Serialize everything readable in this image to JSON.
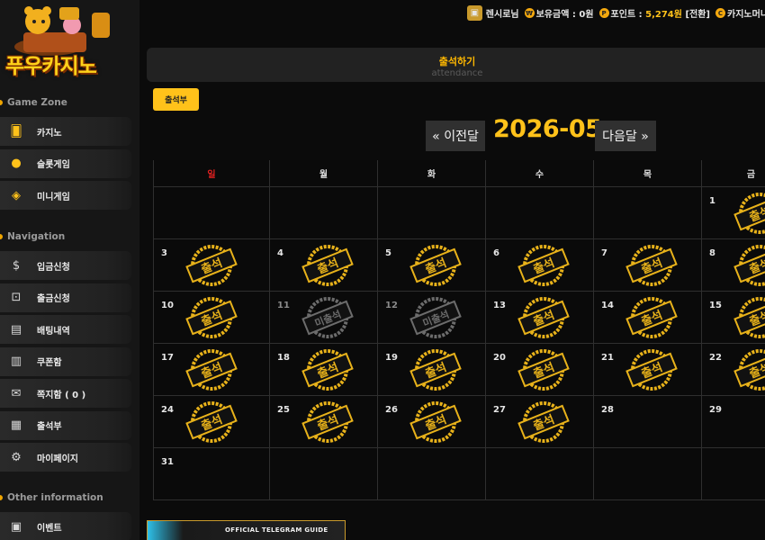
{
  "brand": {
    "logo_text": "푸우카지노"
  },
  "header": {
    "username": "렌시로님",
    "balance_label": "보유금액 :",
    "balance_value": "0원",
    "point_label": "포인트 :",
    "point_value": "5,274원",
    "point_action": "[전환]",
    "casino_money_label": "카지노머니"
  },
  "sidebar": {
    "game_zone_title": "Game Zone",
    "game_items": [
      {
        "label": "카지노",
        "icon": "cards-icon"
      },
      {
        "label": "슬롯게임",
        "icon": "cherry-icon"
      },
      {
        "label": "미니게임",
        "icon": "gamepad-icon"
      }
    ],
    "navigation_title": "Navigation",
    "nav_items": [
      {
        "label": "입금신청",
        "icon": "deposit-icon"
      },
      {
        "label": "출금신청",
        "icon": "withdraw-icon"
      },
      {
        "label": "배팅내역",
        "icon": "betting-history-icon"
      },
      {
        "label": "쿠폰함",
        "icon": "coupon-icon"
      },
      {
        "label": "쪽지함 ( 0 )",
        "icon": "mail-icon"
      },
      {
        "label": "출석부",
        "icon": "calendar-check-icon"
      },
      {
        "label": "마이페이지",
        "icon": "user-settings-icon"
      }
    ],
    "other_title": "Other information",
    "other_items": [
      {
        "label": "이벤트",
        "icon": "gift-icon"
      }
    ]
  },
  "page": {
    "title": "출석하기",
    "subtitle": "attendance",
    "attendance_button": "출석부",
    "prev_label": "« 이전달",
    "month": "2026-05",
    "next_label": "다음달 »"
  },
  "calendar": {
    "weekdays": [
      "일",
      "월",
      "화",
      "수",
      "목",
      "금"
    ],
    "stamp_attended": "출석",
    "stamp_missed": "미출석",
    "weeks": [
      [
        null,
        null,
        null,
        null,
        null,
        {
          "d": "1",
          "s": "attended"
        }
      ],
      [
        {
          "d": "3",
          "s": "attended"
        },
        {
          "d": "4",
          "s": "attended"
        },
        {
          "d": "5",
          "s": "attended"
        },
        {
          "d": "6",
          "s": "attended"
        },
        {
          "d": "7",
          "s": "attended"
        },
        {
          "d": "8",
          "s": "attended"
        }
      ],
      [
        {
          "d": "10",
          "s": "attended"
        },
        {
          "d": "11",
          "s": "missed"
        },
        {
          "d": "12",
          "s": "missed"
        },
        {
          "d": "13",
          "s": "attended"
        },
        {
          "d": "14",
          "s": "attended"
        },
        {
          "d": "15",
          "s": "attended"
        }
      ],
      [
        {
          "d": "17",
          "s": "attended"
        },
        {
          "d": "18",
          "s": "attended"
        },
        {
          "d": "19",
          "s": "attended"
        },
        {
          "d": "20",
          "s": "attended"
        },
        {
          "d": "21",
          "s": "attended"
        },
        {
          "d": "22",
          "s": "attended"
        }
      ],
      [
        {
          "d": "24",
          "s": "attended"
        },
        {
          "d": "25",
          "s": "attended"
        },
        {
          "d": "26",
          "s": "attended"
        },
        {
          "d": "27",
          "s": "attended"
        },
        {
          "d": "28",
          "s": "none"
        },
        {
          "d": "29",
          "s": "none"
        }
      ],
      [
        {
          "d": "31",
          "s": "none"
        },
        null,
        null,
        null,
        null,
        null
      ]
    ]
  },
  "footer_banner": {
    "text": "OFFICIAL TELEGRAM GUIDE"
  },
  "colors": {
    "accent": "#ffc21a",
    "sunday": "#e02020",
    "missed": "#8a8a8a"
  }
}
